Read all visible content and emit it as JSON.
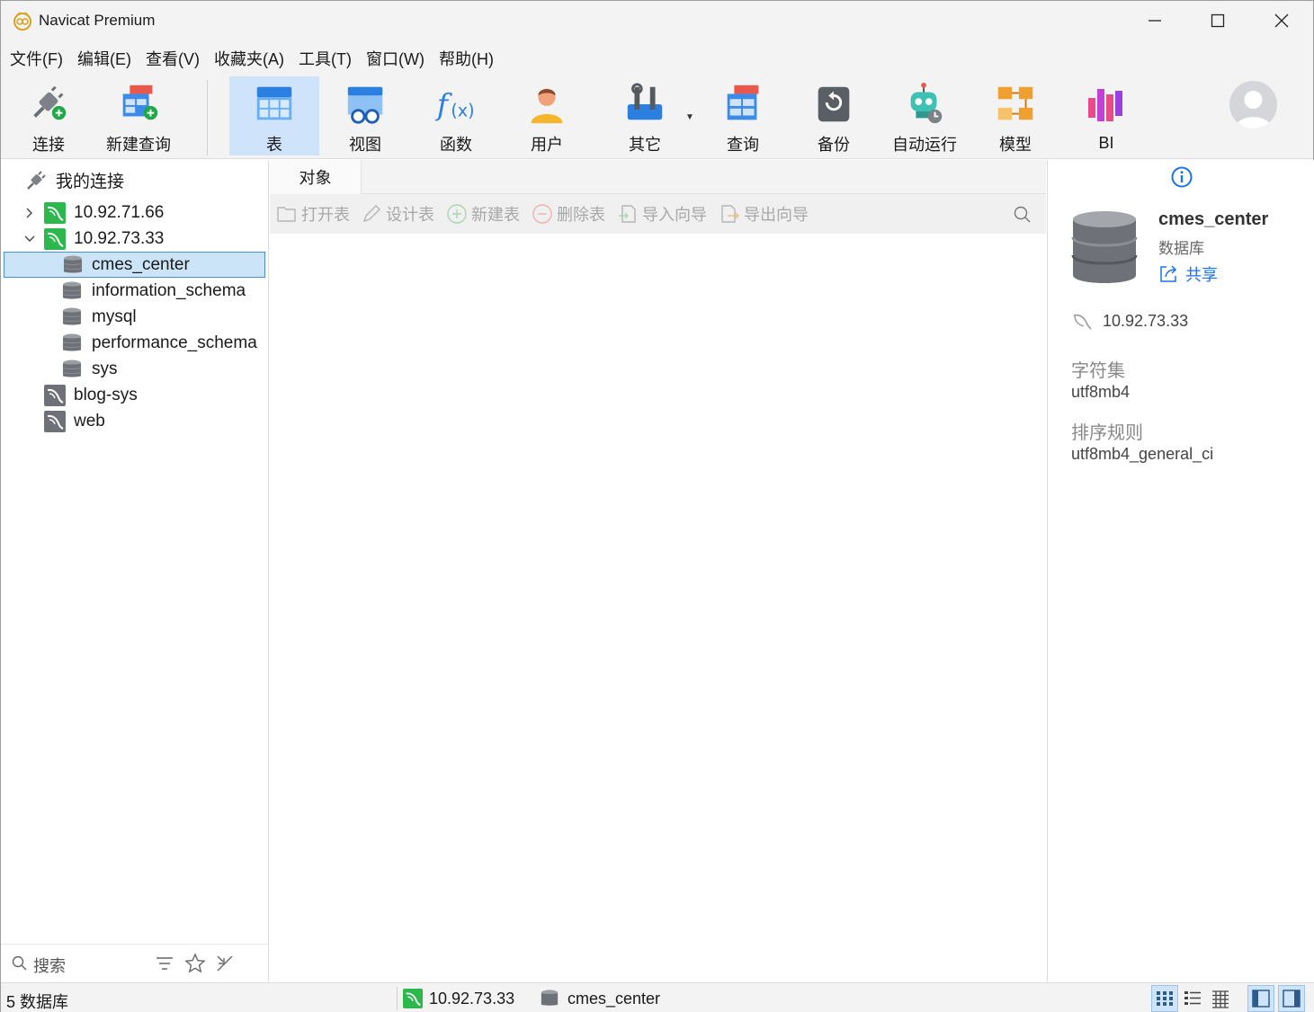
{
  "titlebar": {
    "title": "Navicat Premium"
  },
  "menubar": {
    "items": [
      "文件(F)",
      "编辑(E)",
      "查看(V)",
      "收藏夹(A)",
      "工具(T)",
      "窗口(W)",
      "帮助(H)"
    ]
  },
  "toolbar": {
    "buttons": [
      {
        "label": "连接",
        "icon": "connection-plug-icon"
      },
      {
        "label": "新建查询",
        "icon": "new-query-icon"
      },
      {
        "label": "表",
        "icon": "table-icon",
        "active": true
      },
      {
        "label": "视图",
        "icon": "view-icon"
      },
      {
        "label": "函数",
        "icon": "function-icon"
      },
      {
        "label": "用户",
        "icon": "user-icon"
      },
      {
        "label": "其它",
        "icon": "tools-icon"
      },
      {
        "label": "查询",
        "icon": "query-icon"
      },
      {
        "label": "备份",
        "icon": "backup-icon"
      },
      {
        "label": "自动运行",
        "icon": "robot-icon"
      },
      {
        "label": "模型",
        "icon": "model-icon"
      },
      {
        "label": "BI",
        "icon": "bi-icon"
      }
    ]
  },
  "navigator": {
    "root_label": "我的连接",
    "items": [
      {
        "label": "10.92.71.66",
        "type": "connection",
        "expanded": false
      },
      {
        "label": "10.92.73.33",
        "type": "connection",
        "expanded": true
      },
      {
        "label": "cmes_center",
        "type": "database",
        "selected": true
      },
      {
        "label": "information_schema",
        "type": "database"
      },
      {
        "label": "mysql",
        "type": "database"
      },
      {
        "label": "performance_schema",
        "type": "database"
      },
      {
        "label": "sys",
        "type": "database"
      },
      {
        "label": "blog-sys",
        "type": "connection-closed"
      },
      {
        "label": "web",
        "type": "connection-closed"
      }
    ],
    "search_placeholder": "搜索"
  },
  "center": {
    "tab_label": "对象",
    "object_toolbar": [
      "打开表",
      "设计表",
      "新建表",
      "删除表",
      "导入向导",
      "导出向导"
    ]
  },
  "info_panel": {
    "name": "cmes_center",
    "type": "数据库",
    "share_label": "共享",
    "connection": "10.92.73.33",
    "charset_label": "字符集",
    "charset_value": "utf8mb4",
    "collation_label": "排序规则",
    "collation_value": "utf8mb4_general_ci"
  },
  "statusbar": {
    "count_text": "5 数据库",
    "connection": "10.92.73.33",
    "database": "cmes_center"
  },
  "colors": {
    "accent": "#1a73e8",
    "mysql_green": "#2db84d",
    "selection": "#cce4f7"
  }
}
